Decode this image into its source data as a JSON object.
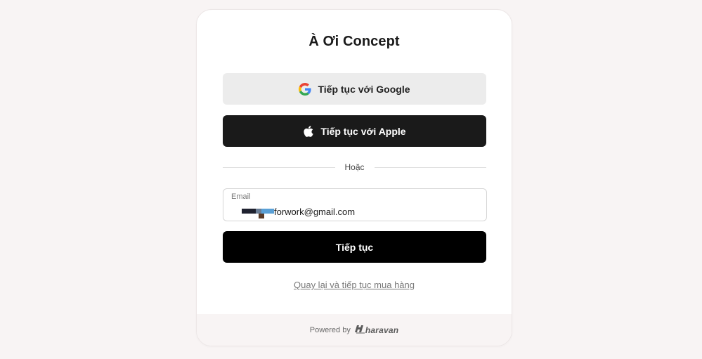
{
  "store": {
    "title": "À Ơi Concept"
  },
  "auth": {
    "google_label": "Tiếp tục với Google",
    "apple_label": "Tiếp tục với Apple",
    "divider_text": "Hoặc",
    "email_label": "Email",
    "email_value": "forwork@gmail.com",
    "continue_label": "Tiếp tục",
    "back_link": "Quay lại và tiếp tục mua hàng"
  },
  "footer": {
    "powered_by": "Powered by",
    "brand": "haravan"
  },
  "icons": {
    "google": "google-icon",
    "apple": "apple-icon",
    "haravan": "haravan-logo-icon"
  },
  "colors": {
    "background": "#f8f4f4",
    "card": "#ffffff",
    "google_button": "#ececec",
    "apple_button": "#1a1a1a",
    "continue_button": "#000000"
  }
}
